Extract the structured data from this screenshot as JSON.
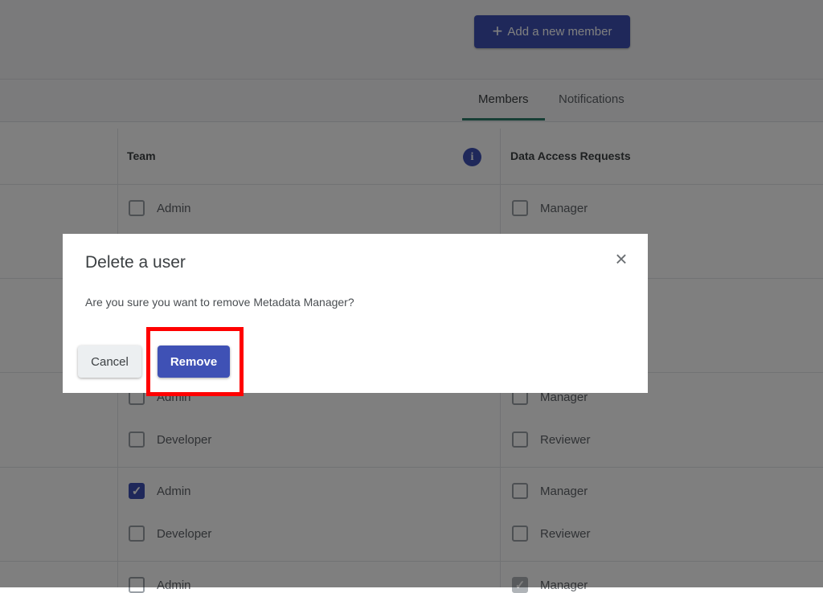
{
  "header": {
    "add_member_label": "Add a new member"
  },
  "tabs": [
    {
      "label": "Members",
      "active": true
    },
    {
      "label": "Notifications",
      "active": false
    }
  ],
  "table": {
    "columns": [
      "Team",
      "Data Access Requests"
    ],
    "rows": [
      {
        "team": [
          {
            "label": "Admin",
            "checked": false
          }
        ],
        "dar": [
          {
            "label": "Manager",
            "checked": false
          }
        ]
      },
      {
        "team": [
          {
            "label": "Admin",
            "checked": false
          },
          {
            "label": "Developer",
            "checked": false
          }
        ],
        "dar": [
          {
            "label": "Manager",
            "checked": false
          },
          {
            "label": "Reviewer",
            "checked": false
          }
        ]
      },
      {
        "team": [
          {
            "label": "Admin",
            "checked": true
          },
          {
            "label": "Developer",
            "checked": false
          }
        ],
        "dar": [
          {
            "label": "Manager",
            "checked": false
          },
          {
            "label": "Reviewer",
            "checked": false
          }
        ]
      },
      {
        "team": [
          {
            "label": "Admin",
            "checked": false
          }
        ],
        "dar": [
          {
            "label": "Manager",
            "checked": true
          }
        ]
      }
    ]
  },
  "dialog": {
    "title": "Delete a user",
    "message": "Are you sure you want to remove Metadata Manager?",
    "cancel_label": "Cancel",
    "remove_label": "Remove"
  },
  "colors": {
    "primary": "#3f51b5",
    "tab_accent": "#2e7d6b",
    "highlight": "#ff0000"
  }
}
